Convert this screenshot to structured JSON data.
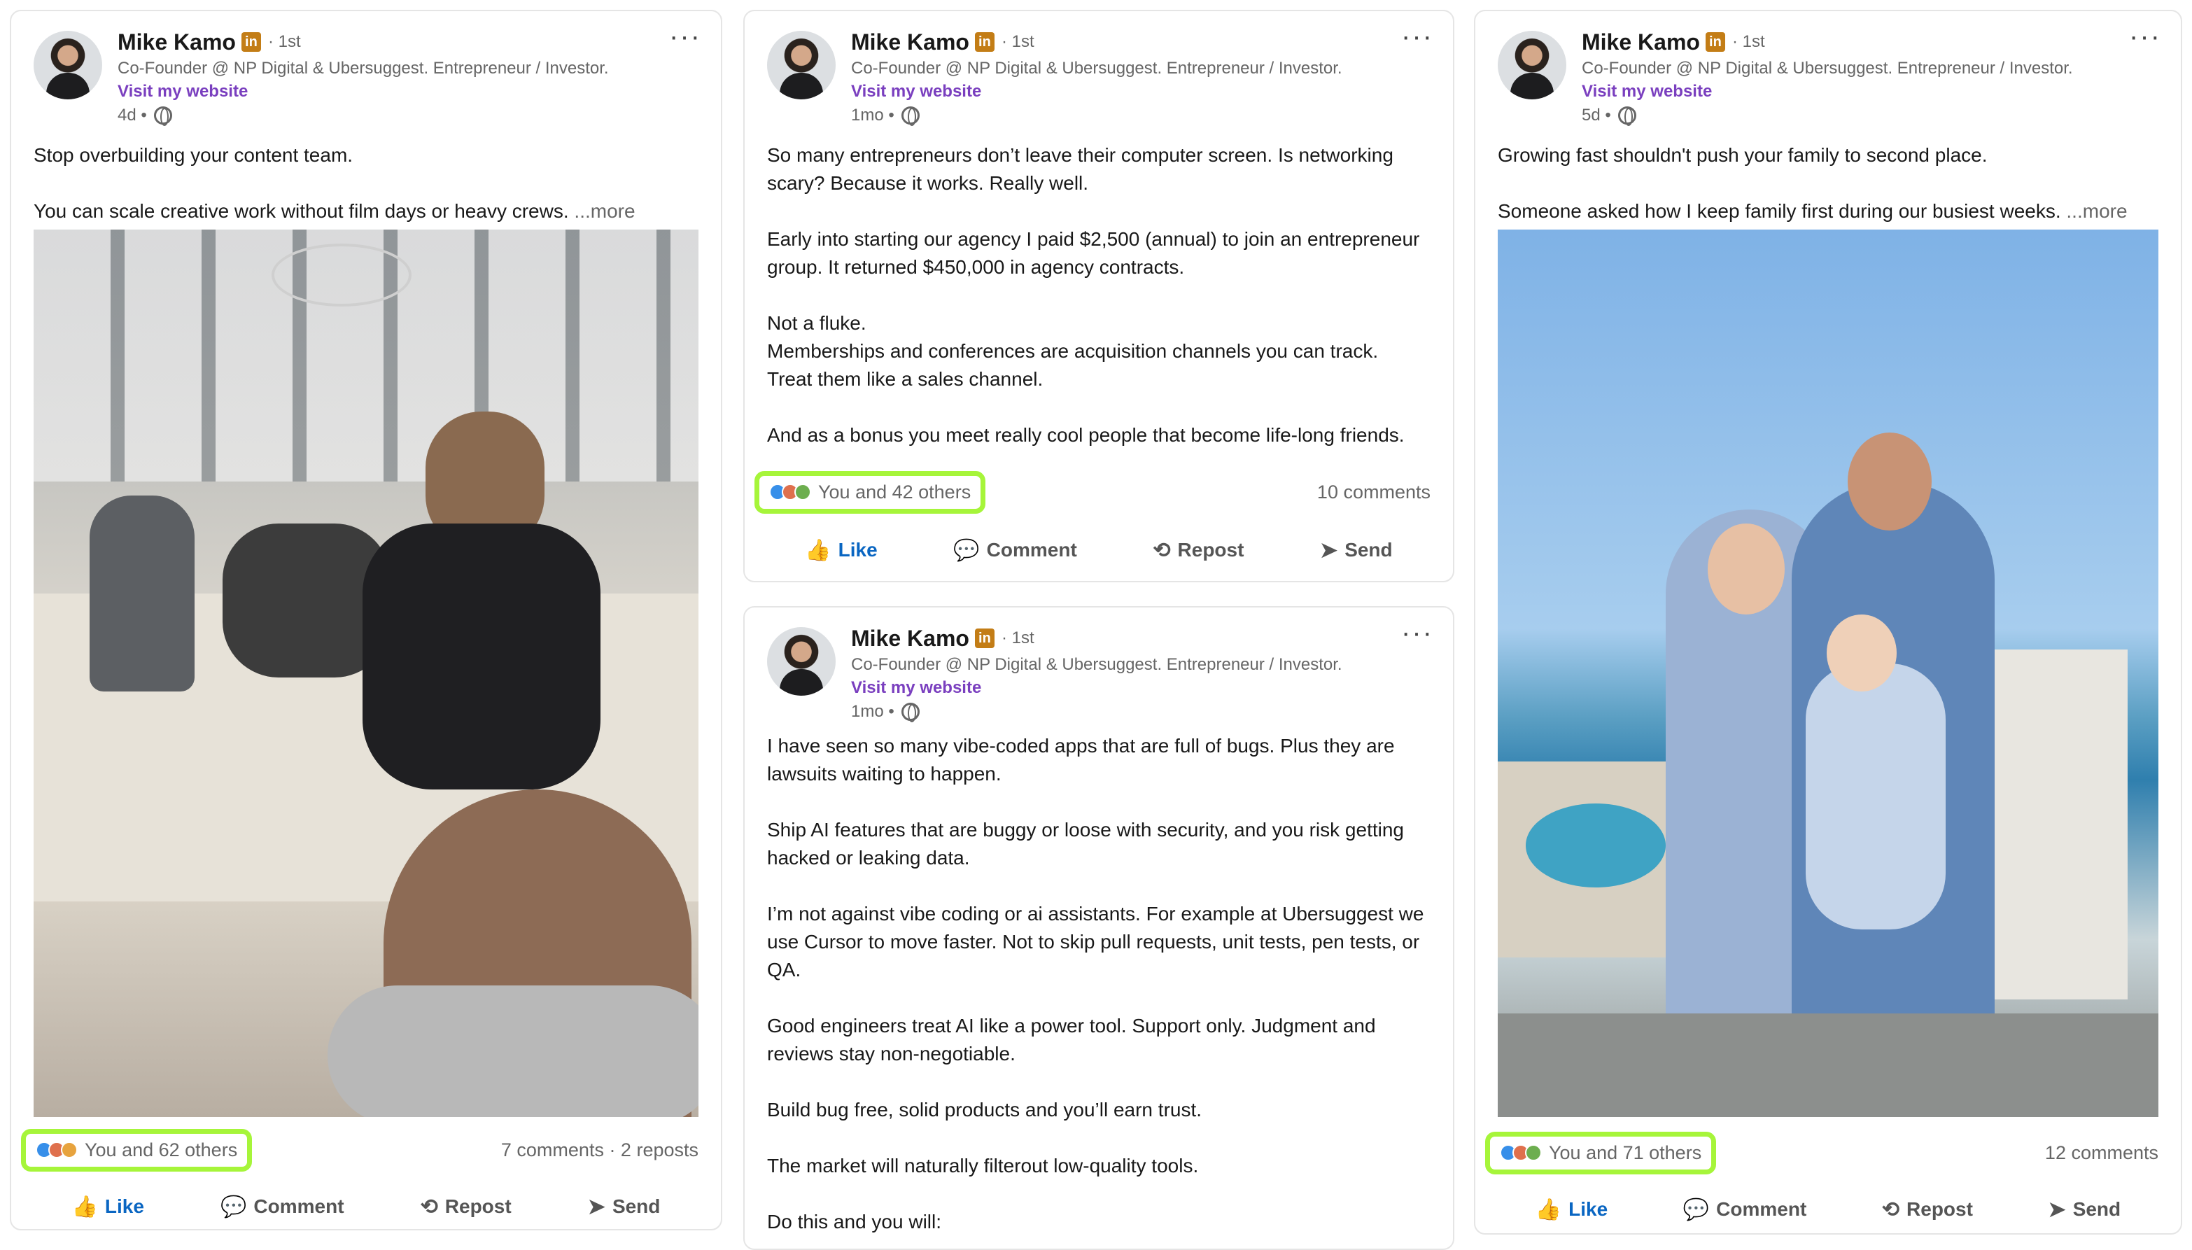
{
  "author": {
    "name": "Mike Kamo",
    "badge": "in",
    "degree": "· 1st",
    "headline": "Co-Founder @ NP Digital & Ubersuggest. Entrepreneur / Investor.",
    "website": "Visit my website"
  },
  "actions": {
    "like": "Like",
    "comment": "Comment",
    "repost": "Repost",
    "send": "Send"
  },
  "see_more": "...more",
  "posts": [
    {
      "time": "4d •",
      "text": "Stop overbuilding your content team.\n\nYou can scale creative work without film days or heavy crews.",
      "reactions": "You and 62 others",
      "stats": "7 comments · 2 reposts"
    },
    {
      "time": "1mo •",
      "text": "So many entrepreneurs don’t leave their computer screen. Is networking scary? Because it works. Really well.\n\n Early into starting our agency I paid $2,500 (annual) to join an entrepreneur group. It returned $450,000 in agency contracts.\n\nNot a fluke.\nMemberships and conferences are acquisition channels you can track.\nTreat them like a sales channel.\n\nAnd as a bonus you meet really cool people that become life-long friends.",
      "reactions": "You and 42 others",
      "stats": "10 comments"
    },
    {
      "time": "1mo •",
      "text": "I have seen so many vibe-coded apps that are full of bugs. Plus they are lawsuits waiting to happen.\n\nShip AI features that are buggy or loose with security, and you risk getting hacked or leaking data.\n\nI’m not against vibe coding or ai assistants. For example at Ubersuggest we use Cursor to move faster. Not to skip pull requests, unit tests, pen tests, or QA.\n\nGood engineers treat AI like a power tool. Support only. Judgment and reviews stay non-negotiable.\n\nBuild bug free, solid products and you’ll earn trust.\n\nThe market will naturally filterout low-quality tools.\n\nDo this and you will:"
    },
    {
      "time": "5d •",
      "text": "Growing fast shouldn't push your family to second place.\n\nSomeone asked how I keep family first during our busiest weeks.",
      "reactions": "You and 71 others",
      "stats": "12 comments"
    }
  ],
  "colors": {
    "highlight": "#a6f53a",
    "like_blue": "#0a66c2",
    "website_purple": "#7a3fbf",
    "badge_gold": "#c37d16"
  }
}
